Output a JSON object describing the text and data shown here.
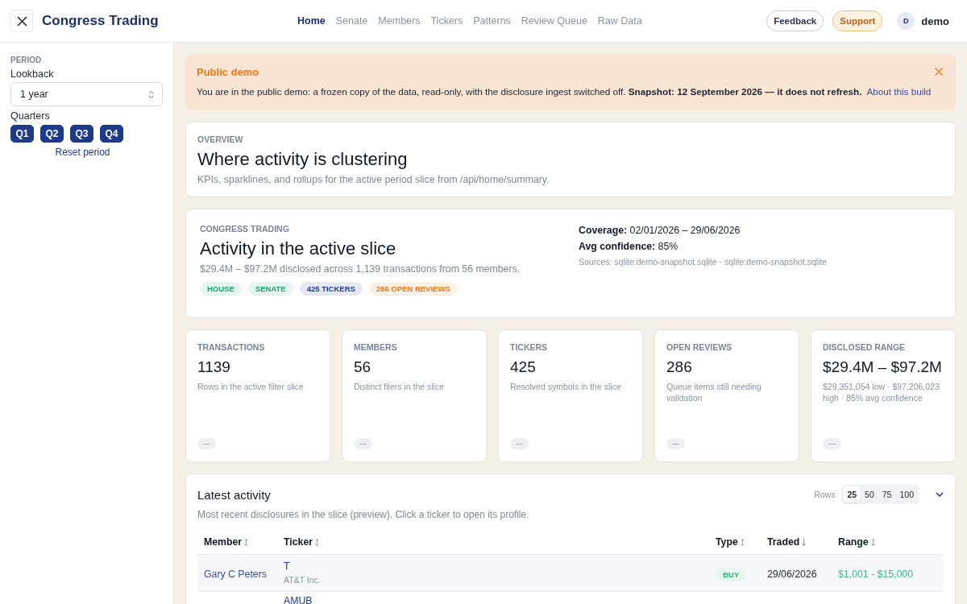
{
  "header": {
    "title": "Congress Trading",
    "nav": [
      {
        "label": "Home",
        "selected": true
      },
      {
        "label": "Senate",
        "selected": false
      },
      {
        "label": "Members",
        "selected": false
      },
      {
        "label": "Tickers",
        "selected": false
      },
      {
        "label": "Patterns",
        "selected": false
      },
      {
        "label": "Review Queue",
        "selected": false
      },
      {
        "label": "Raw Data",
        "selected": false
      }
    ],
    "buttons": [
      {
        "label": "Feedback",
        "kind": "outline"
      },
      {
        "label": "Support",
        "kind": "accent"
      }
    ],
    "user": {
      "initial": "D",
      "name": "demo"
    }
  },
  "sidebar": {
    "section": "PERIOD",
    "lookback": {
      "label": "Lookback",
      "value": "1 year"
    },
    "quarters": {
      "label": "Quarters",
      "items": [
        {
          "label": "Q1",
          "selected": true
        },
        {
          "label": "Q2",
          "selected": true
        },
        {
          "label": "Q3",
          "selected": true
        },
        {
          "label": "Q4",
          "selected": true
        }
      ]
    },
    "reset": "Reset period"
  },
  "notice": {
    "title": "Public demo",
    "text": "You are in the public demo: a frozen copy of the data, read-only, with the disclosure ingest switched off.  **Snapshot: 12 September 2026 — it does not refresh.**",
    "link": "About this build"
  },
  "overview": {
    "eyebrow": "OVERVIEW",
    "title": "Where activity is clustering",
    "subtitle": "KPIs, sparklines, and rollups for the active period slice from /api/home/summary."
  },
  "summary": {
    "eyebrow": "CONGRESS TRADING",
    "title": "Activity in the active slice",
    "text": "$29.4M – $97.2M disclosed across 1,139 transactions from 56 members.",
    "tags": [
      {
        "label": "HOUSE",
        "color": "#1aa36f"
      },
      {
        "label": "SENATE",
        "color": "#1aa36f"
      },
      {
        "label": "425 TICKERS",
        "color": "#1e3a8a"
      },
      {
        "label": "286 OPEN REVIEWS",
        "color": "#ea7a1a"
      }
    ],
    "facts": [
      "**Coverage:** 02/01/2026 – 29/06/2026",
      "**Avg confidence:** 85%"
    ],
    "sources": "Sources: sqlite:demo-snapshot.sqlite · sqlite:demo-snapshot.sqlite"
  },
  "kpis": [
    {
      "label": "TRANSACTIONS",
      "value": "1139",
      "note": "Rows in the active filter slice",
      "spark": "—"
    },
    {
      "label": "MEMBERS",
      "value": "56",
      "note": "Distinct filers in the slice",
      "spark": "—"
    },
    {
      "label": "TICKERS",
      "value": "425",
      "note": "Resolved symbols in the slice",
      "spark": "—"
    },
    {
      "label": "OPEN REVIEWS",
      "value": "286",
      "note": "Queue items still needing validation",
      "spark": "—"
    },
    {
      "label": "DISCLOSED RANGE",
      "value": "$29.4M – $97.2M",
      "note": "$29,351,054 low · $97,206,023 high · 85% avg confidence",
      "spark": "—"
    }
  ],
  "activity": {
    "title": "Latest activity",
    "subtitle": "Most recent disclosures in the slice (preview). Click a ticker to open its profile.",
    "rows_label": "Rows",
    "row_options": [
      {
        "label": "25",
        "selected": true
      },
      {
        "label": "50",
        "selected": false
      },
      {
        "label": "75",
        "selected": false
      },
      {
        "label": "100",
        "selected": false
      }
    ],
    "columns": [
      {
        "label": "Member",
        "sorted": false
      },
      {
        "label": "Ticker",
        "sorted": false
      },
      {
        "label": "Type",
        "sorted": false
      },
      {
        "label": "Traded",
        "sorted": true
      },
      {
        "label": "Range",
        "sorted": false
      }
    ],
    "rows": [
      {
        "member": "Gary C Peters",
        "ticker": "T",
        "company": "AT&T Inc.",
        "type": "BUY",
        "traded": "29/06/2026",
        "range": "$1,001 - $15,000"
      },
      {
        "ticker": "AMUB"
      }
    ]
  }
}
